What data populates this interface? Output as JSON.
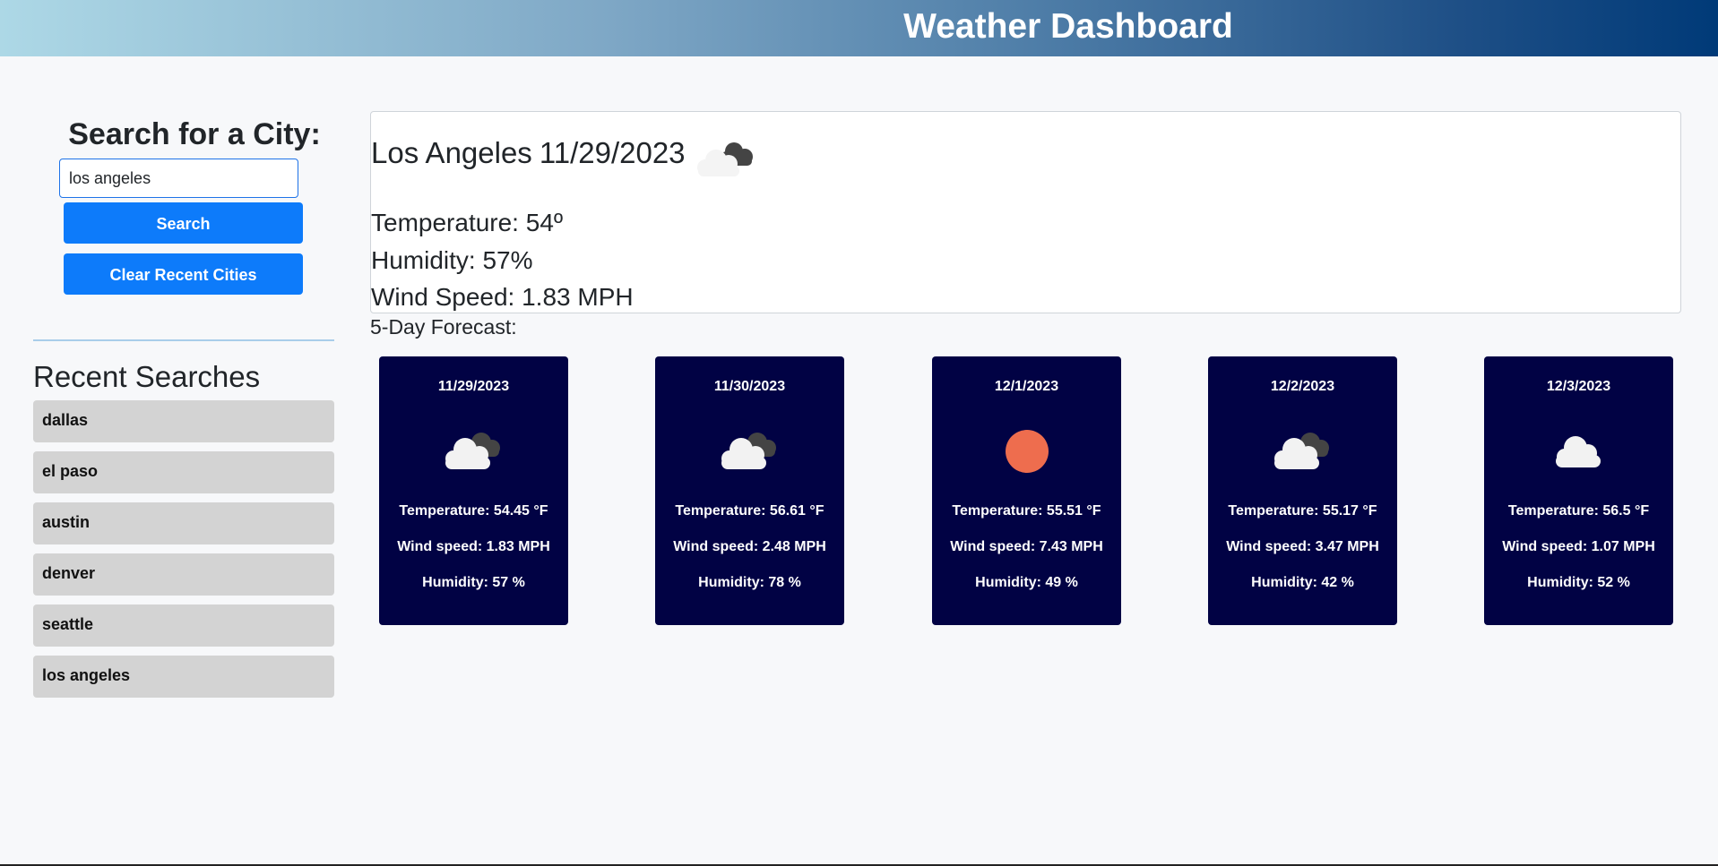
{
  "header": {
    "title": "Weather Dashboard"
  },
  "sidebar": {
    "search_title": "Search for a City:",
    "search_value": "los angeles",
    "search_button": "Search",
    "clear_button": "Clear Recent Cities",
    "recent_title": "Recent Searches",
    "recent": [
      "dallas",
      "el paso",
      "austin",
      "denver",
      "seattle",
      "los angeles"
    ]
  },
  "current": {
    "city": "Los Angeles",
    "date": "11/29/2023",
    "icon": "few-clouds-icon",
    "temperature": "Temperature: 54º",
    "humidity": "Humidity: 57%",
    "wind": "Wind Speed: 1.83 MPH"
  },
  "forecast": {
    "label": "5-Day Forecast:",
    "days": [
      {
        "date": "11/29/2023",
        "icon": "broken-clouds-icon",
        "temp": "Temperature: 54.45 °F",
        "wind": "Wind speed: 1.83 MPH",
        "humidity": "Humidity: 57 %"
      },
      {
        "date": "11/30/2023",
        "icon": "broken-clouds-icon",
        "temp": "Temperature: 56.61 °F",
        "wind": "Wind speed: 2.48 MPH",
        "humidity": "Humidity: 78 %"
      },
      {
        "date": "12/1/2023",
        "icon": "clear-sun-icon",
        "temp": "Temperature: 55.51 °F",
        "wind": "Wind speed: 7.43 MPH",
        "humidity": "Humidity: 49 %"
      },
      {
        "date": "12/2/2023",
        "icon": "broken-clouds-icon",
        "temp": "Temperature: 55.17 °F",
        "wind": "Wind speed: 3.47 MPH",
        "humidity": "Humidity: 42 %"
      },
      {
        "date": "12/3/2023",
        "icon": "scattered-cloud-icon",
        "temp": "Temperature: 56.5 °F",
        "wind": "Wind speed: 1.07 MPH",
        "humidity": "Humidity: 52 %"
      }
    ]
  },
  "colors": {
    "card_bg": "#010244",
    "button": "#0d7bfa",
    "sun": "#ee6d4e",
    "cloud_light": "#f2f2f2",
    "cloud_dark": "#444444"
  }
}
